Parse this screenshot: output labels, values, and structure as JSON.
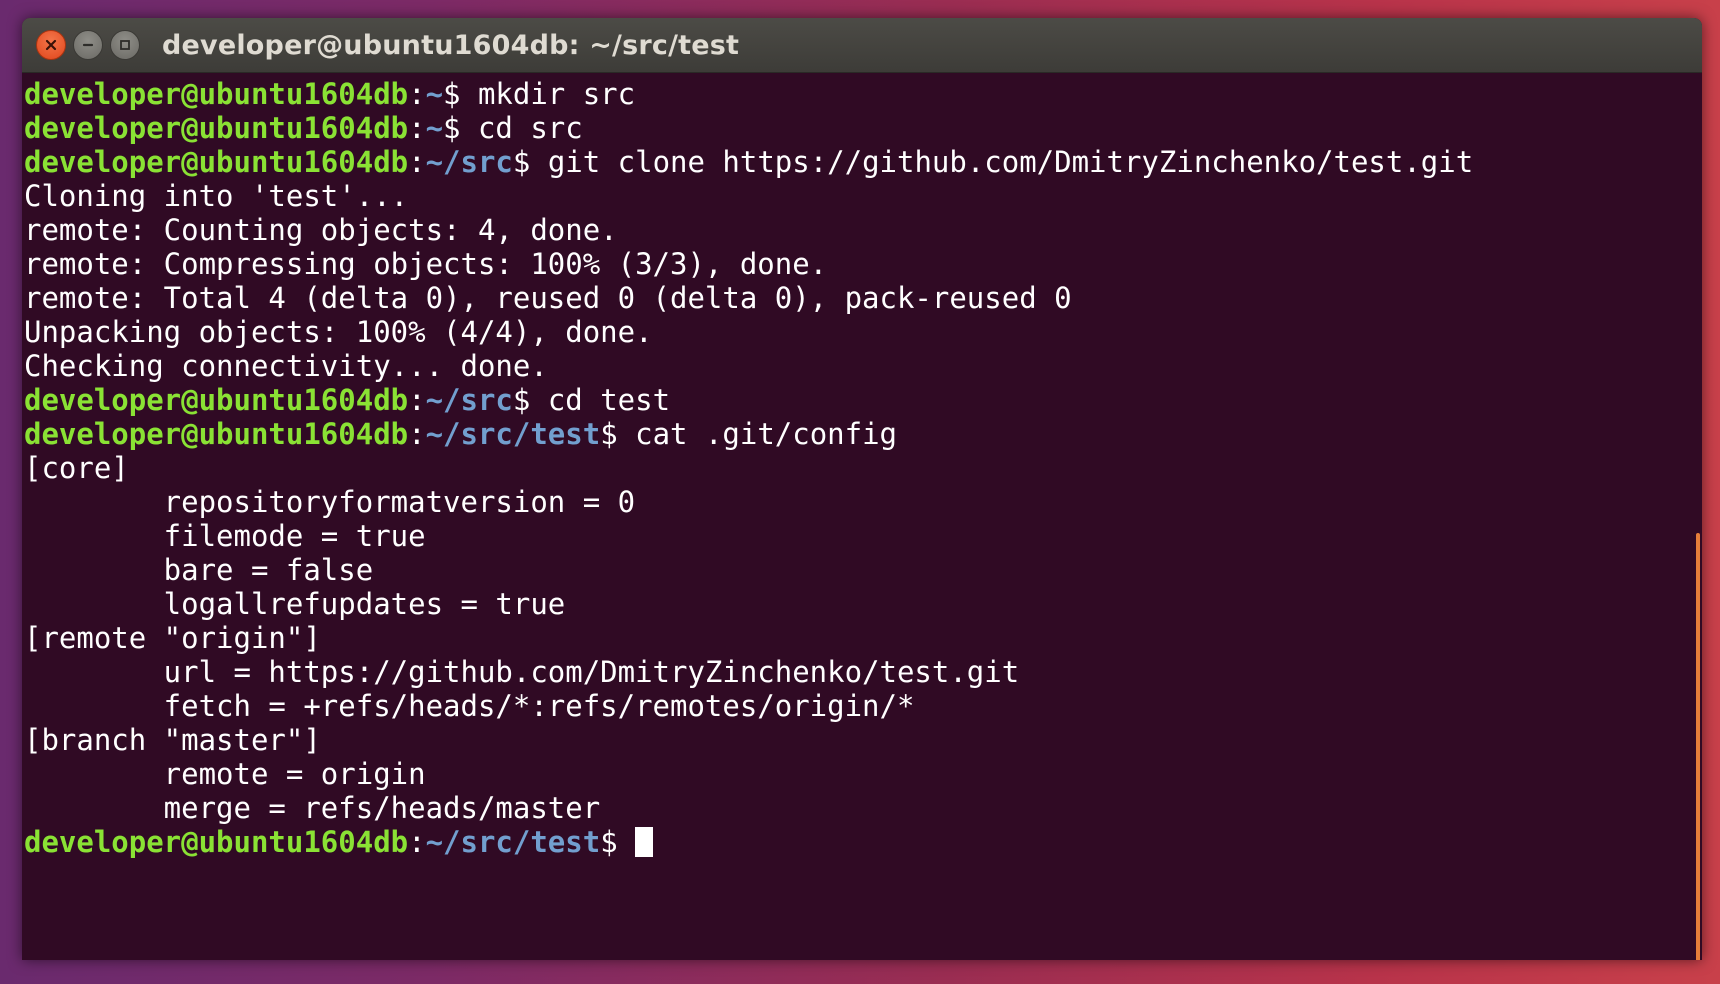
{
  "window": {
    "title": "developer@ubuntu1604db: ~/src/test",
    "controls": {
      "close_icon": "close-icon",
      "minimize_icon": "minimize-icon",
      "maximize_icon": "maximize-icon"
    }
  },
  "colors": {
    "background": "#300a24",
    "prompt_user": "#8ae234",
    "prompt_path": "#729fcf",
    "text": "#ffffff",
    "close_button": "#e0461c",
    "scrollbar": "#e67e3a"
  },
  "terminal": {
    "lines": [
      {
        "user": "developer@ubuntu1604db",
        "sep": ":",
        "path": "~",
        "prompt": "$ ",
        "text": "mkdir src"
      },
      {
        "user": "developer@ubuntu1604db",
        "sep": ":",
        "path": "~",
        "prompt": "$ ",
        "text": "cd src"
      },
      {
        "user": "developer@ubuntu1604db",
        "sep": ":",
        "path": "~/src",
        "prompt": "$ ",
        "text": "git clone https://github.com/DmitryZinchenko/test.git"
      },
      {
        "text": "Cloning into 'test'..."
      },
      {
        "text": "remote: Counting objects: 4, done."
      },
      {
        "text": "remote: Compressing objects: 100% (3/3), done."
      },
      {
        "text": "remote: Total 4 (delta 0), reused 0 (delta 0), pack-reused 0"
      },
      {
        "text": "Unpacking objects: 100% (4/4), done."
      },
      {
        "text": "Checking connectivity... done."
      },
      {
        "user": "developer@ubuntu1604db",
        "sep": ":",
        "path": "~/src",
        "prompt": "$ ",
        "text": "cd test"
      },
      {
        "user": "developer@ubuntu1604db",
        "sep": ":",
        "path": "~/src/test",
        "prompt": "$ ",
        "text": "cat .git/config"
      },
      {
        "text": "[core]"
      },
      {
        "text": "        repositoryformatversion = 0"
      },
      {
        "text": "        filemode = true"
      },
      {
        "text": "        bare = false"
      },
      {
        "text": "        logallrefupdates = true"
      },
      {
        "text": "[remote \"origin\"]"
      },
      {
        "text": "        url = https://github.com/DmitryZinchenko/test.git"
      },
      {
        "text": "        fetch = +refs/heads/*:refs/remotes/origin/*"
      },
      {
        "text": "[branch \"master\"]"
      },
      {
        "text": "        remote = origin"
      },
      {
        "text": "        merge = refs/heads/master"
      }
    ],
    "current_prompt": {
      "user": "developer@ubuntu1604db",
      "sep": ":",
      "path": "~/src/test",
      "prompt": "$ "
    }
  }
}
